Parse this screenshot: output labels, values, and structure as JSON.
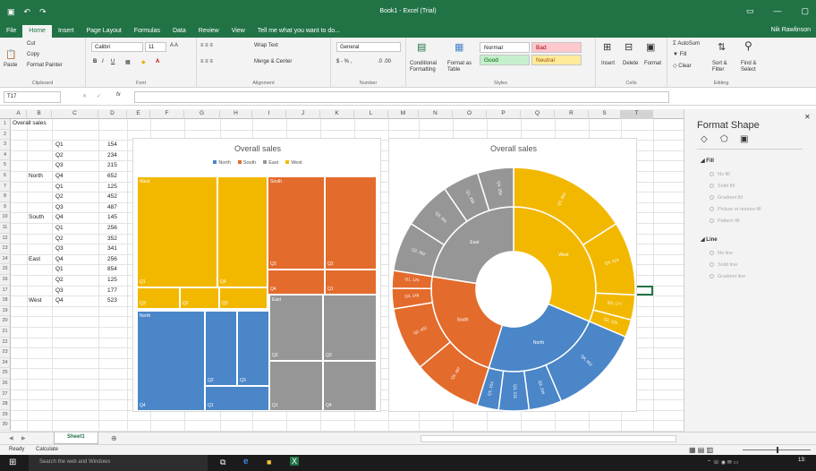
{
  "window": {
    "title": "Book1 - Excel (Trial)",
    "user": "Nik Rawlinson"
  },
  "tabs": [
    "File",
    "Home",
    "Insert",
    "Page Layout",
    "Formulas",
    "Data",
    "Review",
    "View",
    "Tell me what you want to do..."
  ],
  "ribbon": {
    "clipboard": {
      "cut": "Cut",
      "copy": "Copy",
      "paste": "Paste",
      "format_painter": "Format Painter",
      "label": "Clipboard"
    },
    "font": {
      "name": "Calibri",
      "size": "11",
      "label": "Font"
    },
    "alignment": {
      "wrap": "Wrap Text",
      "merge": "Merge & Center",
      "label": "Alignment"
    },
    "number": {
      "format": "General",
      "label": "Number"
    },
    "styles": {
      "conditional": "Conditional Formatting",
      "format_as_table": "Format as Table",
      "normal": "Normal",
      "bad": "Bad",
      "good": "Good",
      "neutral": "Neutral",
      "label": "Styles"
    },
    "cells": {
      "insert": "Insert",
      "delete": "Delete",
      "format": "Format",
      "label": "Cells"
    },
    "editing": {
      "autosum": "AutoSum",
      "fill": "Fill",
      "clear": "Clear",
      "sort": "Sort & Filter",
      "find": "Find & Select",
      "label": "Editing"
    }
  },
  "formula_bar": {
    "name_box": "T17",
    "fx": "fx"
  },
  "columns": [
    "A",
    "B",
    "C",
    "D",
    "E",
    "F",
    "G",
    "H",
    "I",
    "J",
    "K",
    "L",
    "M",
    "N",
    "O",
    "P",
    "Q",
    "R",
    "S",
    "T"
  ],
  "rows": [
    "1",
    "2",
    "3",
    "4",
    "5",
    "6",
    "7",
    "8",
    "9",
    "10",
    "11",
    "12",
    "13",
    "14",
    "15",
    "16",
    "17",
    "18",
    "19",
    "20",
    "21",
    "22",
    "23",
    "24",
    "25",
    "26",
    "27",
    "28",
    "29",
    "30"
  ],
  "sheet": {
    "a1": "Overall sales",
    "regions": [
      {
        "name": "North",
        "row": 6
      },
      {
        "name": "South",
        "row": 10
      },
      {
        "name": "East",
        "row": 14
      },
      {
        "name": "West",
        "row": 18
      }
    ],
    "data": [
      {
        "q": "Q1",
        "v": "154"
      },
      {
        "q": "Q2",
        "v": "234"
      },
      {
        "q": "Q3",
        "v": "215"
      },
      {
        "q": "Q4",
        "v": "652"
      },
      {
        "q": "Q1",
        "v": "125"
      },
      {
        "q": "Q2",
        "v": "452"
      },
      {
        "q": "Q3",
        "v": "487"
      },
      {
        "q": "Q4",
        "v": "145"
      },
      {
        "q": "Q1",
        "v": "256"
      },
      {
        "q": "Q2",
        "v": "352"
      },
      {
        "q": "Q3",
        "v": "341"
      },
      {
        "q": "Q4",
        "v": "256"
      },
      {
        "q": "Q1",
        "v": "854"
      },
      {
        "q": "Q2",
        "v": "125"
      },
      {
        "q": "Q3",
        "v": "177"
      },
      {
        "q": "Q4",
        "v": "523"
      }
    ]
  },
  "chart_data": [
    {
      "type": "treemap",
      "title": "Overall sales",
      "legend": [
        "North",
        "South",
        "East",
        "West"
      ],
      "colors": {
        "North": "#4a86c8",
        "South": "#e36b2c",
        "East": "#969696",
        "West": "#f2b800"
      },
      "series": [
        {
          "name": "North",
          "values": [
            154,
            234,
            215,
            652
          ]
        },
        {
          "name": "South",
          "values": [
            125,
            452,
            487,
            145
          ]
        },
        {
          "name": "East",
          "values": [
            256,
            352,
            341,
            256
          ]
        },
        {
          "name": "West",
          "values": [
            854,
            125,
            177,
            523
          ]
        }
      ],
      "labels": {
        "West": [
          "West",
          "Q1",
          "Q4",
          "Q3",
          "Q2"
        ],
        "South": [
          "South",
          "Q3",
          "Q2",
          "Q4",
          "Q1"
        ],
        "North": [
          "North",
          "Q4",
          "Q2",
          "Q3",
          "Q1"
        ],
        "East": [
          "East",
          "Q2",
          "Q3",
          "Q1",
          "Q4"
        ]
      }
    },
    {
      "type": "sunburst",
      "title": "Overall sales",
      "rings": {
        "inner": [
          "West",
          "North",
          "South",
          "East"
        ]
      },
      "labels": {
        "West": [
          "Q1, 854",
          "Q4, 523",
          "Q3, 177",
          "Q2, 125"
        ],
        "North": [
          "Q4, 652",
          "Q2, 234",
          "Q3, 215",
          "Q1, 154"
        ],
        "South": [
          "Q3, 487",
          "Q2, 452",
          "Q4, 145",
          "Q1, 125"
        ],
        "East": [
          "Q2, 352",
          "Q3, 341",
          "Q1, 256",
          "Q4, 256"
        ]
      }
    }
  ],
  "panel": {
    "title": "Format Shape",
    "fill": "Fill",
    "line": "Line",
    "fill_options": [
      "No fill",
      "Solid fill",
      "Gradient fill",
      "Picture or texture fill",
      "Pattern fill"
    ],
    "line_options": [
      "No line",
      "Solid line",
      "Gradient line"
    ]
  },
  "sheet_tabs": {
    "active": "Sheet1"
  },
  "status": {
    "ready": "Ready",
    "calc": "Calculate"
  },
  "taskbar": {
    "search": "Search the web and Windows",
    "time": "13:"
  }
}
